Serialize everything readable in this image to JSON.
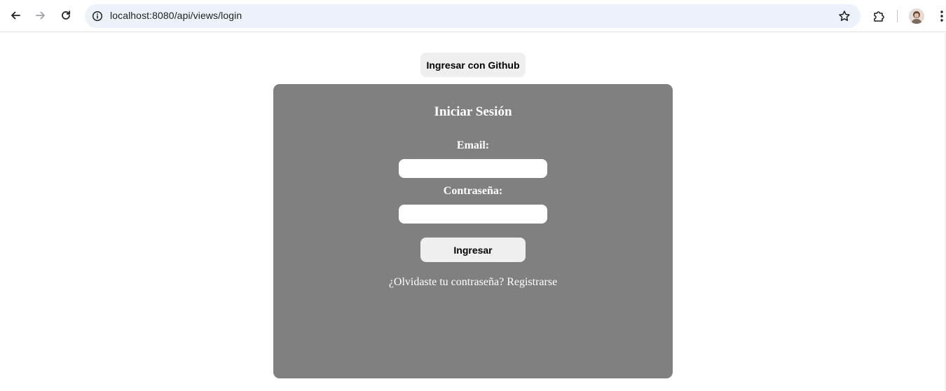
{
  "browser": {
    "url": "localhost:8080/api/views/login"
  },
  "page": {
    "github_button": "Ingresar con Github",
    "form": {
      "title": "Iniciar Sesión",
      "email_label": "Email:",
      "email_value": "",
      "password_label": "Contraseña:",
      "password_value": "",
      "submit_label": "Ingresar",
      "forgot_link": "¿Olvidaste tu contraseña?",
      "register_link": "Registrarse"
    }
  },
  "colors": {
    "card_background": "#808080",
    "button_background": "#efefef",
    "omnibox_background": "#edf2fa"
  },
  "icons": {
    "back": "back-arrow-icon",
    "forward": "forward-arrow-icon",
    "reload": "reload-icon",
    "site_info": "info-icon",
    "bookmark": "star-icon",
    "extensions": "puzzle-icon",
    "menu": "kebab-menu-icon"
  }
}
